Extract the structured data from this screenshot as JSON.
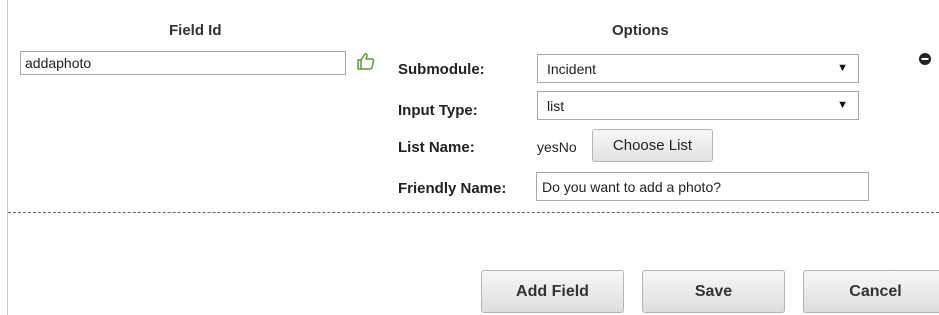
{
  "headers": {
    "field_id": "Field Id",
    "options": "Options"
  },
  "field": {
    "id_value": "addaphoto",
    "icons": {
      "valid": "thumbs-up-icon",
      "remove": "minus-circle-icon"
    },
    "colors": {
      "valid_icon": "#5a9e2a"
    }
  },
  "options": {
    "submodule_label": "Submodule:",
    "submodule_value": "Incident",
    "input_type_label": "Input Type:",
    "input_type_value": "list",
    "list_name_label": "List Name:",
    "list_name_value": "yesNo",
    "choose_list_label": "Choose List",
    "friendly_name_label": "Friendly Name:",
    "friendly_name_value": "Do you want to add a photo?"
  },
  "actions": {
    "add_field": "Add Field",
    "save": "Save",
    "cancel": "Cancel"
  }
}
